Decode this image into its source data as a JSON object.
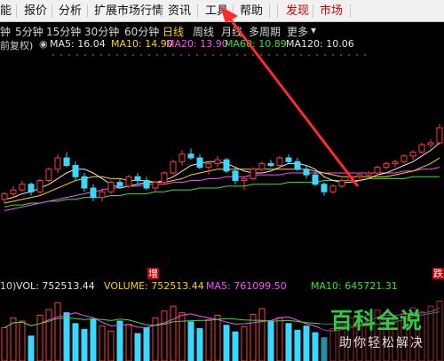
{
  "menu": {
    "items": [
      {
        "label": "能",
        "active": false
      },
      {
        "label": "报价",
        "active": false
      },
      {
        "label": "分析",
        "active": false
      },
      {
        "label": "扩展市场行情",
        "active": false
      },
      {
        "label": "资讯",
        "active": false
      },
      {
        "label": "工具",
        "active": false
      },
      {
        "label": "帮助",
        "active": false
      },
      {
        "label": "发现",
        "active": true
      },
      {
        "label": "市场",
        "active": true
      }
    ]
  },
  "periods": {
    "items": [
      {
        "label": "钟",
        "selected": false
      },
      {
        "label": "5分钟",
        "selected": false
      },
      {
        "label": "15分钟",
        "selected": false
      },
      {
        "label": "30分钟",
        "selected": false
      },
      {
        "label": "60分钟",
        "selected": false
      },
      {
        "label": "日线",
        "selected": true
      },
      {
        "label": "周线",
        "selected": false
      },
      {
        "label": "月线",
        "selected": false
      },
      {
        "label": "多周期",
        "selected": false
      },
      {
        "label": "更多",
        "selected": false
      }
    ],
    "more_icon": "caret-down-icon"
  },
  "ma_legend": {
    "prefix": "前复权)",
    "items": [
      {
        "label": "MA5: 16.04",
        "color": "#e6e6e6"
      },
      {
        "label": "MA10: 14.90",
        "color": "#ffd200"
      },
      {
        "label": "MA20: 13.90",
        "color": "#ff4dff"
      },
      {
        "label": "MA60: 10.89",
        "color": "#33e633"
      },
      {
        "label": "MA120: 10.06",
        "color": "#e6e6e6"
      }
    ]
  },
  "volume_legend": {
    "prefix": "10)",
    "items": [
      {
        "label": "VOL: 752513.44",
        "color": "#e6e6e6"
      },
      {
        "label": "VOLUME: 752513.44",
        "color": "#ffd200"
      },
      {
        "label": "MA5: 761099.50",
        "color": "#ff4dff"
      },
      {
        "label": "MA10: 645721.31",
        "color": "#33e633"
      }
    ]
  },
  "tags": {
    "left": "增",
    "right": "跌"
  },
  "watermark": {
    "title": "百科全说",
    "subtitle": "助你轻松解决"
  },
  "colors": {
    "up": "#ff3c3c",
    "down": "#3ad7ff",
    "ma5": "#e6e6e6",
    "ma10": "#ffd200",
    "ma20": "#ff4dff",
    "ma60": "#33e633",
    "annotation_arrow": "#ff2a2a"
  },
  "chart_data": {
    "type": "candlestick",
    "candles": [
      [
        12.2,
        12.6,
        12.0,
        12.5
      ],
      [
        12.5,
        12.9,
        12.3,
        12.7
      ],
      [
        12.7,
        13.2,
        12.6,
        13.0
      ],
      [
        13.0,
        13.1,
        12.4,
        12.6
      ],
      [
        12.6,
        13.3,
        12.5,
        13.2
      ],
      [
        13.2,
        13.9,
        13.1,
        13.8
      ],
      [
        13.8,
        14.6,
        13.6,
        14.4
      ],
      [
        14.4,
        14.7,
        13.9,
        14.0
      ],
      [
        14.0,
        14.2,
        13.2,
        13.4
      ],
      [
        13.4,
        13.6,
        12.6,
        12.8
      ],
      [
        12.8,
        13.0,
        12.1,
        12.3
      ],
      [
        12.3,
        12.8,
        12.1,
        12.6
      ],
      [
        12.6,
        13.2,
        12.5,
        13.1
      ],
      [
        13.1,
        13.3,
        12.8,
        12.9
      ],
      [
        12.9,
        13.5,
        12.8,
        13.4
      ],
      [
        13.4,
        13.6,
        13.0,
        13.2
      ],
      [
        13.2,
        13.4,
        12.7,
        12.8
      ],
      [
        12.8,
        13.2,
        12.6,
        13.1
      ],
      [
        13.1,
        13.7,
        13.0,
        13.6
      ],
      [
        13.6,
        14.3,
        13.5,
        14.2
      ],
      [
        14.2,
        14.8,
        14.0,
        14.6
      ],
      [
        14.6,
        14.9,
        14.3,
        14.4
      ],
      [
        14.4,
        14.6,
        13.8,
        13.9
      ],
      [
        13.9,
        14.2,
        13.5,
        14.1
      ],
      [
        14.1,
        14.5,
        13.9,
        14.3
      ],
      [
        14.3,
        14.4,
        13.6,
        13.7
      ],
      [
        13.7,
        13.9,
        13.0,
        13.2
      ],
      [
        13.2,
        13.4,
        12.7,
        13.3
      ],
      [
        13.3,
        13.9,
        13.2,
        13.8
      ],
      [
        13.8,
        14.2,
        13.7,
        14.1
      ],
      [
        14.1,
        14.3,
        13.9,
        14.0
      ],
      [
        14.0,
        14.5,
        13.9,
        14.4
      ],
      [
        14.4,
        14.6,
        14.1,
        14.2
      ],
      [
        14.2,
        14.4,
        13.7,
        13.8
      ],
      [
        13.8,
        14.0,
        13.3,
        13.5
      ],
      [
        13.5,
        13.7,
        12.9,
        13.0
      ],
      [
        13.0,
        13.1,
        12.4,
        12.6
      ],
      [
        12.6,
        13.0,
        12.5,
        12.9
      ],
      [
        12.9,
        13.3,
        12.8,
        13.2
      ],
      [
        13.2,
        13.5,
        13.1,
        13.4
      ],
      [
        13.4,
        13.6,
        13.2,
        13.5
      ],
      [
        13.5,
        13.7,
        13.3,
        13.6
      ],
      [
        13.6,
        14.0,
        13.5,
        13.9
      ],
      [
        13.9,
        14.2,
        13.8,
        14.1
      ],
      [
        14.1,
        14.3,
        13.9,
        14.2
      ],
      [
        14.2,
        14.6,
        14.1,
        14.5
      ],
      [
        14.5,
        14.8,
        14.3,
        14.7
      ],
      [
        14.7,
        15.2,
        14.6,
        15.1
      ],
      [
        15.1,
        15.4,
        14.9,
        15.2
      ],
      [
        15.2,
        16.2,
        15.1,
        16.0
      ]
    ],
    "ma5": [
      12.2,
      12.3,
      12.5,
      12.6,
      12.8,
      13.0,
      13.3,
      13.6,
      13.8,
      13.8,
      13.6,
      13.3,
      13.0,
      12.8,
      12.9,
      13.0,
      13.1,
      13.1,
      13.2,
      13.4,
      13.7,
      14.0,
      14.1,
      14.2,
      14.2,
      14.1,
      13.9,
      13.7,
      13.6,
      13.6,
      13.7,
      13.9,
      14.1,
      14.1,
      14.0,
      13.8,
      13.4,
      13.2,
      13.1,
      13.1,
      13.2,
      13.3,
      13.5,
      13.6,
      13.8,
      14.0,
      14.2,
      14.5,
      14.8,
      15.2
    ],
    "ma10": [
      12.0,
      12.1,
      12.2,
      12.3,
      12.4,
      12.6,
      12.8,
      13.0,
      13.2,
      13.3,
      13.4,
      13.4,
      13.3,
      13.3,
      13.2,
      13.2,
      13.2,
      13.1,
      13.1,
      13.2,
      13.3,
      13.5,
      13.6,
      13.7,
      13.8,
      13.8,
      13.8,
      13.8,
      13.8,
      13.8,
      13.8,
      13.8,
      13.8,
      13.8,
      13.8,
      13.7,
      13.6,
      13.5,
      13.4,
      13.4,
      13.4,
      13.4,
      13.4,
      13.4,
      13.5,
      13.6,
      13.7,
      13.9,
      14.1,
      14.4
    ],
    "ma20": [
      11.6,
      11.7,
      11.8,
      11.9,
      12.0,
      12.1,
      12.2,
      12.3,
      12.4,
      12.5,
      12.6,
      12.7,
      12.8,
      12.8,
      12.9,
      12.9,
      13.0,
      13.0,
      13.0,
      13.1,
      13.1,
      13.2,
      13.2,
      13.3,
      13.3,
      13.4,
      13.4,
      13.4,
      13.5,
      13.5,
      13.5,
      13.5,
      13.6,
      13.6,
      13.6,
      13.6,
      13.6,
      13.6,
      13.6,
      13.6,
      13.6,
      13.6,
      13.6,
      13.6,
      13.6,
      13.7,
      13.7,
      13.8,
      13.8,
      13.9
    ],
    "ma60": [
      11.8,
      11.9,
      11.9,
      12.0,
      12.0,
      12.1,
      12.1,
      12.2,
      12.2,
      12.3,
      12.3,
      12.3,
      12.4,
      12.4,
      12.5,
      12.5,
      12.5,
      12.6,
      12.6,
      12.7,
      12.7,
      12.7,
      12.8,
      12.8,
      12.8,
      12.9,
      12.9,
      12.9,
      13.0,
      13.0,
      13.0,
      13.0,
      13.1,
      13.1,
      13.1,
      13.1,
      13.2,
      13.2,
      13.2,
      13.2,
      13.2,
      13.3,
      13.3,
      13.3,
      13.3,
      13.3,
      13.4,
      13.4,
      13.4,
      13.4
    ],
    "volume": [
      40,
      52,
      48,
      30,
      55,
      62,
      70,
      58,
      45,
      38,
      50,
      42,
      36,
      48,
      44,
      33,
      40,
      52,
      60,
      66,
      58,
      47,
      39,
      50,
      55,
      43,
      35,
      41,
      56,
      63,
      48,
      52,
      45,
      37,
      42,
      34,
      28,
      39,
      46,
      52,
      49,
      55,
      61,
      58,
      50,
      57,
      64,
      59,
      66,
      72
    ],
    "price_ylim": [
      8,
      20
    ],
    "volume_ylim": [
      0,
      80
    ]
  }
}
